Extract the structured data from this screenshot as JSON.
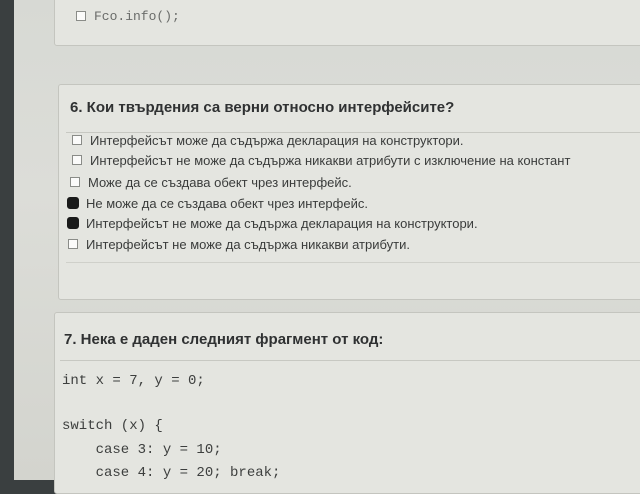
{
  "prev_question": {
    "last_option": "Fco.info();"
  },
  "question6": {
    "title": "6. Кои твърдения са верни относно интерфейсите?",
    "options": [
      {
        "label": "Интерфейсът може да съдържа декларация на конструктори.",
        "checked": false
      },
      {
        "label": "Интерфейсът не може да съдържа никакви атрибути с изключение на констант",
        "checked": false
      },
      {
        "label": "Може да се създава обект чрез интерфейс.",
        "checked": false
      },
      {
        "label": "Не може да се създава обект чрез интерфейс.",
        "checked": true
      },
      {
        "label": "Интерфейсът не може да съдържа декларация на конструктори.",
        "checked": true
      },
      {
        "label": "Интерфейсът не може да съдържа никакви атрибути.",
        "checked": false
      }
    ]
  },
  "question7": {
    "title": "7. Нека е даден следният фрагмент от код:",
    "code": [
      "int x = 7, y = 0;",
      "",
      "switch (x) {",
      "    case 3: y = 10;",
      "    case 4: y = 20; break;"
    ]
  },
  "colors": {
    "screen_bg": "#dcddd8",
    "panel_bg": "#e4e5e0",
    "text": "#3a3c3b",
    "checked_mark": "#1a1a1a"
  }
}
